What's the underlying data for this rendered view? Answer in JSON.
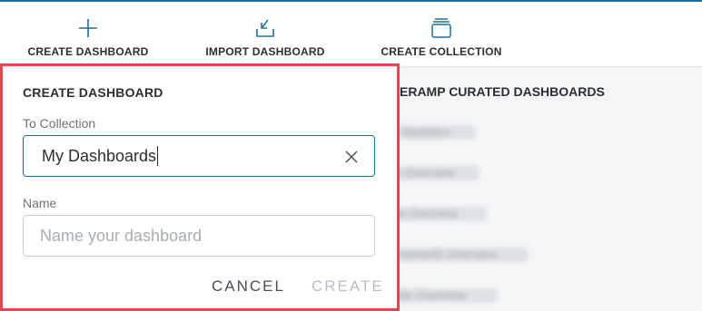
{
  "toolbar": {
    "create_dashboard": "CREATE DASHBOARD",
    "import_dashboard": "IMPORT DASHBOARD",
    "create_collection": "CREATE COLLECTION"
  },
  "icons": {
    "create": "plus-icon",
    "import": "import-icon",
    "collection": "collection-stack-icon"
  },
  "colors": {
    "accent": "#1f6f9c",
    "highlight_border": "#e8454f",
    "disabled_text": "#b7bdc2"
  },
  "curated": {
    "title": "ERAMP CURATED DASHBOARDS",
    "items": [
      "t Statistics",
      "s Overview",
      "ts Overview",
      "ntainerID Overview",
      "der Overview"
    ]
  },
  "dialog": {
    "title": "CREATE DASHBOARD",
    "collection_label": "To Collection",
    "collection_value": "My Dashboards",
    "name_label": "Name",
    "name_placeholder": "Name your dashboard",
    "cancel_label": "CANCEL",
    "create_label": "CREATE"
  }
}
